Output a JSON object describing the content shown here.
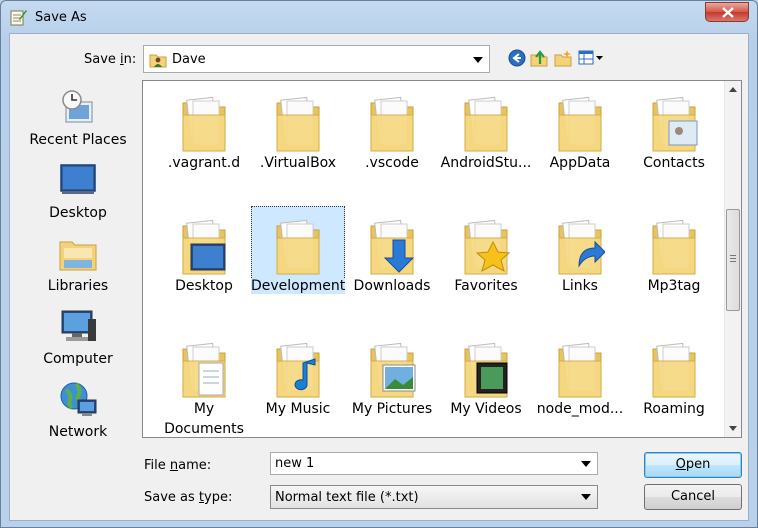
{
  "window": {
    "title": "Save As",
    "close_icon": "close-icon"
  },
  "header": {
    "save_in_label_pre": "Save ",
    "save_in_label_u": "i",
    "save_in_label_post": "n:",
    "save_in_value": "Dave",
    "toolbar_icons": [
      "back-icon",
      "up-folder-icon",
      "new-folder-icon",
      "view-menu-icon"
    ]
  },
  "places": [
    {
      "label": "Recent Places",
      "icon": "recent-places-icon"
    },
    {
      "label": "Desktop",
      "icon": "desktop-icon"
    },
    {
      "label": "Libraries",
      "icon": "libraries-icon"
    },
    {
      "label": "Computer",
      "icon": "computer-icon"
    },
    {
      "label": "Network",
      "icon": "network-icon"
    }
  ],
  "files": [
    {
      "label": ".vagrant.d",
      "icon": "folder-icon"
    },
    {
      "label": ".VirtualBox",
      "icon": "folder-icon"
    },
    {
      "label": ".vscode",
      "icon": "folder-icon"
    },
    {
      "label": "AndroidStu...",
      "icon": "folder-icon"
    },
    {
      "label": "AppData",
      "icon": "folder-icon"
    },
    {
      "label": "Contacts",
      "icon": "contacts-folder-icon"
    },
    {
      "label": "Desktop",
      "icon": "desktop-folder-icon"
    },
    {
      "label": "Development",
      "icon": "folder-icon",
      "selected": true
    },
    {
      "label": "Downloads",
      "icon": "downloads-folder-icon"
    },
    {
      "label": "Favorites",
      "icon": "favorites-folder-icon"
    },
    {
      "label": "Links",
      "icon": "links-folder-icon"
    },
    {
      "label": "Mp3tag",
      "icon": "folder-icon"
    },
    {
      "label": "My Documents",
      "icon": "documents-folder-icon"
    },
    {
      "label": "My Music",
      "icon": "music-folder-icon"
    },
    {
      "label": "My Pictures",
      "icon": "pictures-folder-icon"
    },
    {
      "label": "My Videos",
      "icon": "videos-folder-icon"
    },
    {
      "label": "node_mod...",
      "icon": "folder-icon"
    },
    {
      "label": "Roaming",
      "icon": "folder-icon"
    }
  ],
  "footer": {
    "file_name_label_pre": "File ",
    "file_name_label_u": "n",
    "file_name_label_post": "ame:",
    "file_name_value": "new 1",
    "save_type_label_pre": "Save as ",
    "save_type_label_u": "t",
    "save_type_label_post": "ype:",
    "save_type_value": "Normal text file (*.txt)",
    "open_label_u": "O",
    "open_label_post": "pen",
    "cancel_label": "Cancel"
  }
}
